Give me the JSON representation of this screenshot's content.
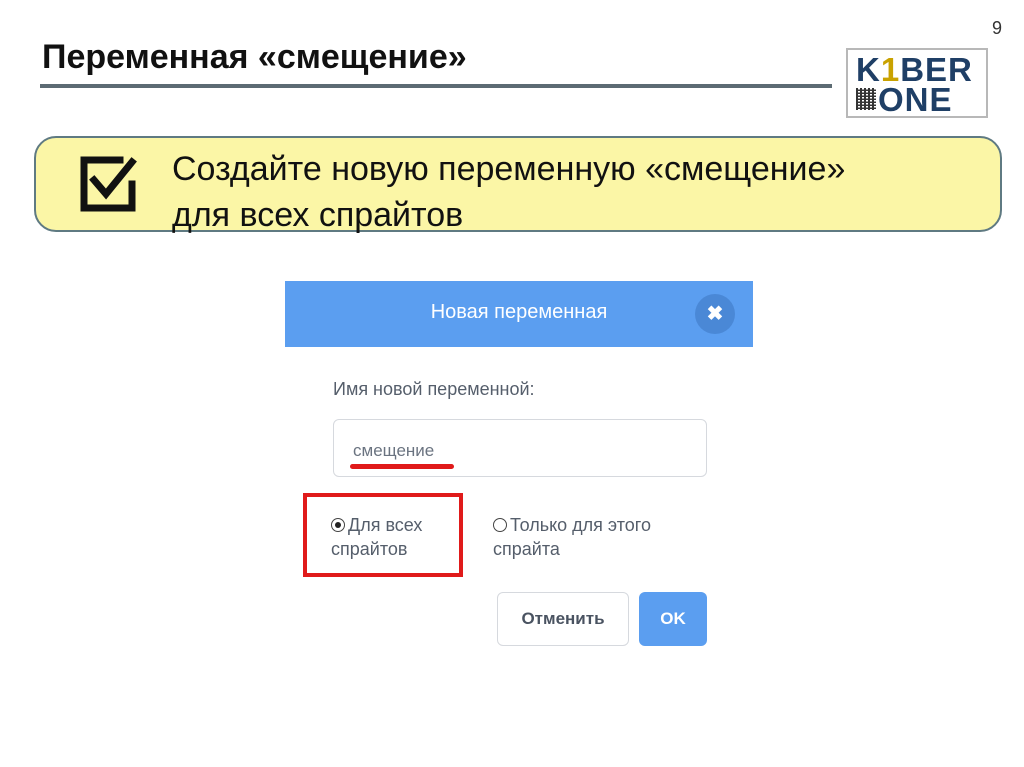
{
  "page_number": "9",
  "slide": {
    "title": "Переменная «смещение»",
    "task_line1": "Создайте новую переменную «смещение»",
    "task_line2": "для всех спрайтов",
    "task_icon": "checkbox-checked-icon"
  },
  "logo": {
    "line1": "K1BER",
    "line2": "ONE",
    "icon": "qr-code-icon"
  },
  "dialog": {
    "title": "Новая переменная",
    "close_icon": "close-icon",
    "field_label": "Имя новой переменной:",
    "input_value": "смещение",
    "radio_all_line1": "Для всех",
    "radio_all_line2": "спрайтов",
    "radio_this_line1": "Только для этого",
    "radio_this_line2": "спрайта",
    "selected_scope": "Для всех спрайтов",
    "cancel_label": "Отменить",
    "ok_label": "OK"
  },
  "colors": {
    "dialog_header": "#5b9ef0",
    "task_box_fill": "#fbf6a6",
    "highlight": "#e01a1a"
  }
}
